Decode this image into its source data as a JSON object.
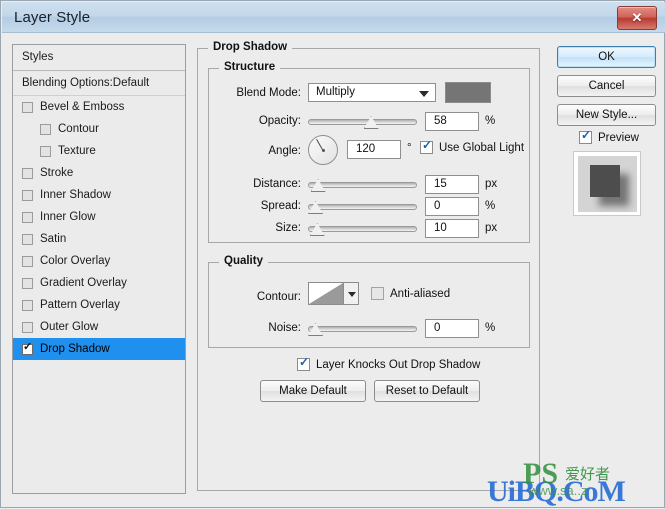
{
  "window": {
    "title": "Layer Style",
    "close_icon": "close-icon"
  },
  "styles_panel": {
    "header": "Styles",
    "blending_options": "Blending Options:Default",
    "items": [
      {
        "label": "Bevel & Emboss",
        "checked": false,
        "indent": false,
        "selected": false
      },
      {
        "label": "Contour",
        "checked": false,
        "indent": true,
        "selected": false
      },
      {
        "label": "Texture",
        "checked": false,
        "indent": true,
        "selected": false
      },
      {
        "label": "Stroke",
        "checked": false,
        "indent": false,
        "selected": false
      },
      {
        "label": "Inner Shadow",
        "checked": false,
        "indent": false,
        "selected": false
      },
      {
        "label": "Inner Glow",
        "checked": false,
        "indent": false,
        "selected": false
      },
      {
        "label": "Satin",
        "checked": false,
        "indent": false,
        "selected": false
      },
      {
        "label": "Color Overlay",
        "checked": false,
        "indent": false,
        "selected": false
      },
      {
        "label": "Gradient Overlay",
        "checked": false,
        "indent": false,
        "selected": false
      },
      {
        "label": "Pattern Overlay",
        "checked": false,
        "indent": false,
        "selected": false
      },
      {
        "label": "Outer Glow",
        "checked": false,
        "indent": false,
        "selected": false
      },
      {
        "label": "Drop Shadow",
        "checked": true,
        "indent": false,
        "selected": true
      }
    ]
  },
  "drop_shadow": {
    "group_title": "Drop Shadow",
    "structure": {
      "group_title": "Structure",
      "blend_mode_label": "Blend Mode:",
      "blend_mode_value": "Multiply",
      "shadow_color": "#757575",
      "opacity_label": "Opacity:",
      "opacity_value": "58",
      "opacity_unit": "%",
      "angle_label": "Angle:",
      "angle_value": "120",
      "angle_unit": "°",
      "use_global_light_label": "Use Global Light",
      "use_global_light_checked": true,
      "distance_label": "Distance:",
      "distance_value": "15",
      "distance_unit": "px",
      "spread_label": "Spread:",
      "spread_value": "0",
      "spread_unit": "%",
      "size_label": "Size:",
      "size_value": "10",
      "size_unit": "px"
    },
    "quality": {
      "group_title": "Quality",
      "contour_label": "Contour:",
      "anti_aliased_label": "Anti-aliased",
      "anti_aliased_checked": false,
      "noise_label": "Noise:",
      "noise_value": "0",
      "noise_unit": "%"
    },
    "knockout_label": "Layer Knocks Out Drop Shadow",
    "knockout_checked": true,
    "make_default_label": "Make Default",
    "reset_default_label": "Reset to Default"
  },
  "actions": {
    "ok_label": "OK",
    "cancel_label": "Cancel",
    "new_style_label": "New Style...",
    "preview_label": "Preview",
    "preview_checked": true
  },
  "watermark": {
    "main": "UiBQ.CoM",
    "ps": "PS",
    "cn": "爱好者",
    "url": "www.sa..z"
  }
}
